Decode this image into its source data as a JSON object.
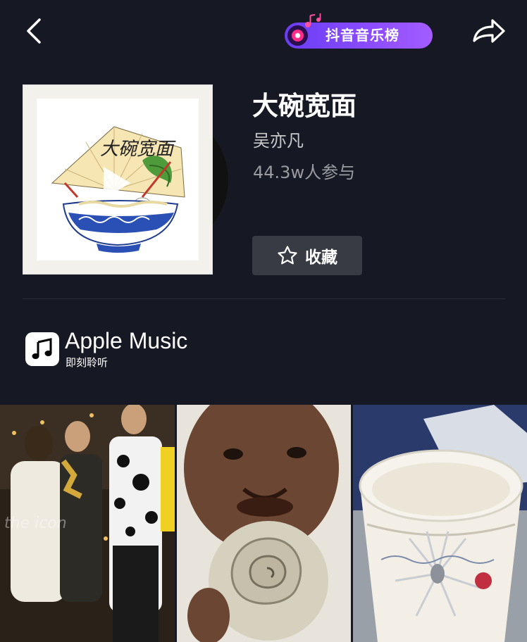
{
  "header": {
    "back_icon": "chevron-left-icon",
    "share_icon": "share-arrow-icon",
    "badge": {
      "label": "抖音音乐榜",
      "icon": "music-disc-icon"
    }
  },
  "song": {
    "title": "大碗宽面",
    "artist": "吴亦凡",
    "participants": "44.3w人参与",
    "cover_text": "大碗宽面"
  },
  "favorite": {
    "label": "收藏",
    "icon": "star-outline-icon"
  },
  "apple_music": {
    "name": "Apple Music",
    "subtitle": "即刻聆听",
    "icon": "music-note-icon"
  },
  "videos": [
    {
      "caption": "the icon"
    },
    {
      "caption": ""
    },
    {
      "caption": ""
    }
  ],
  "colors": {
    "background": "#161823",
    "badge_start": "#6a3df2",
    "badge_end": "#a35cff",
    "button_bg": "#393b44",
    "secondary_text": "#c8c9cc",
    "muted_text": "#9a9ba1"
  }
}
